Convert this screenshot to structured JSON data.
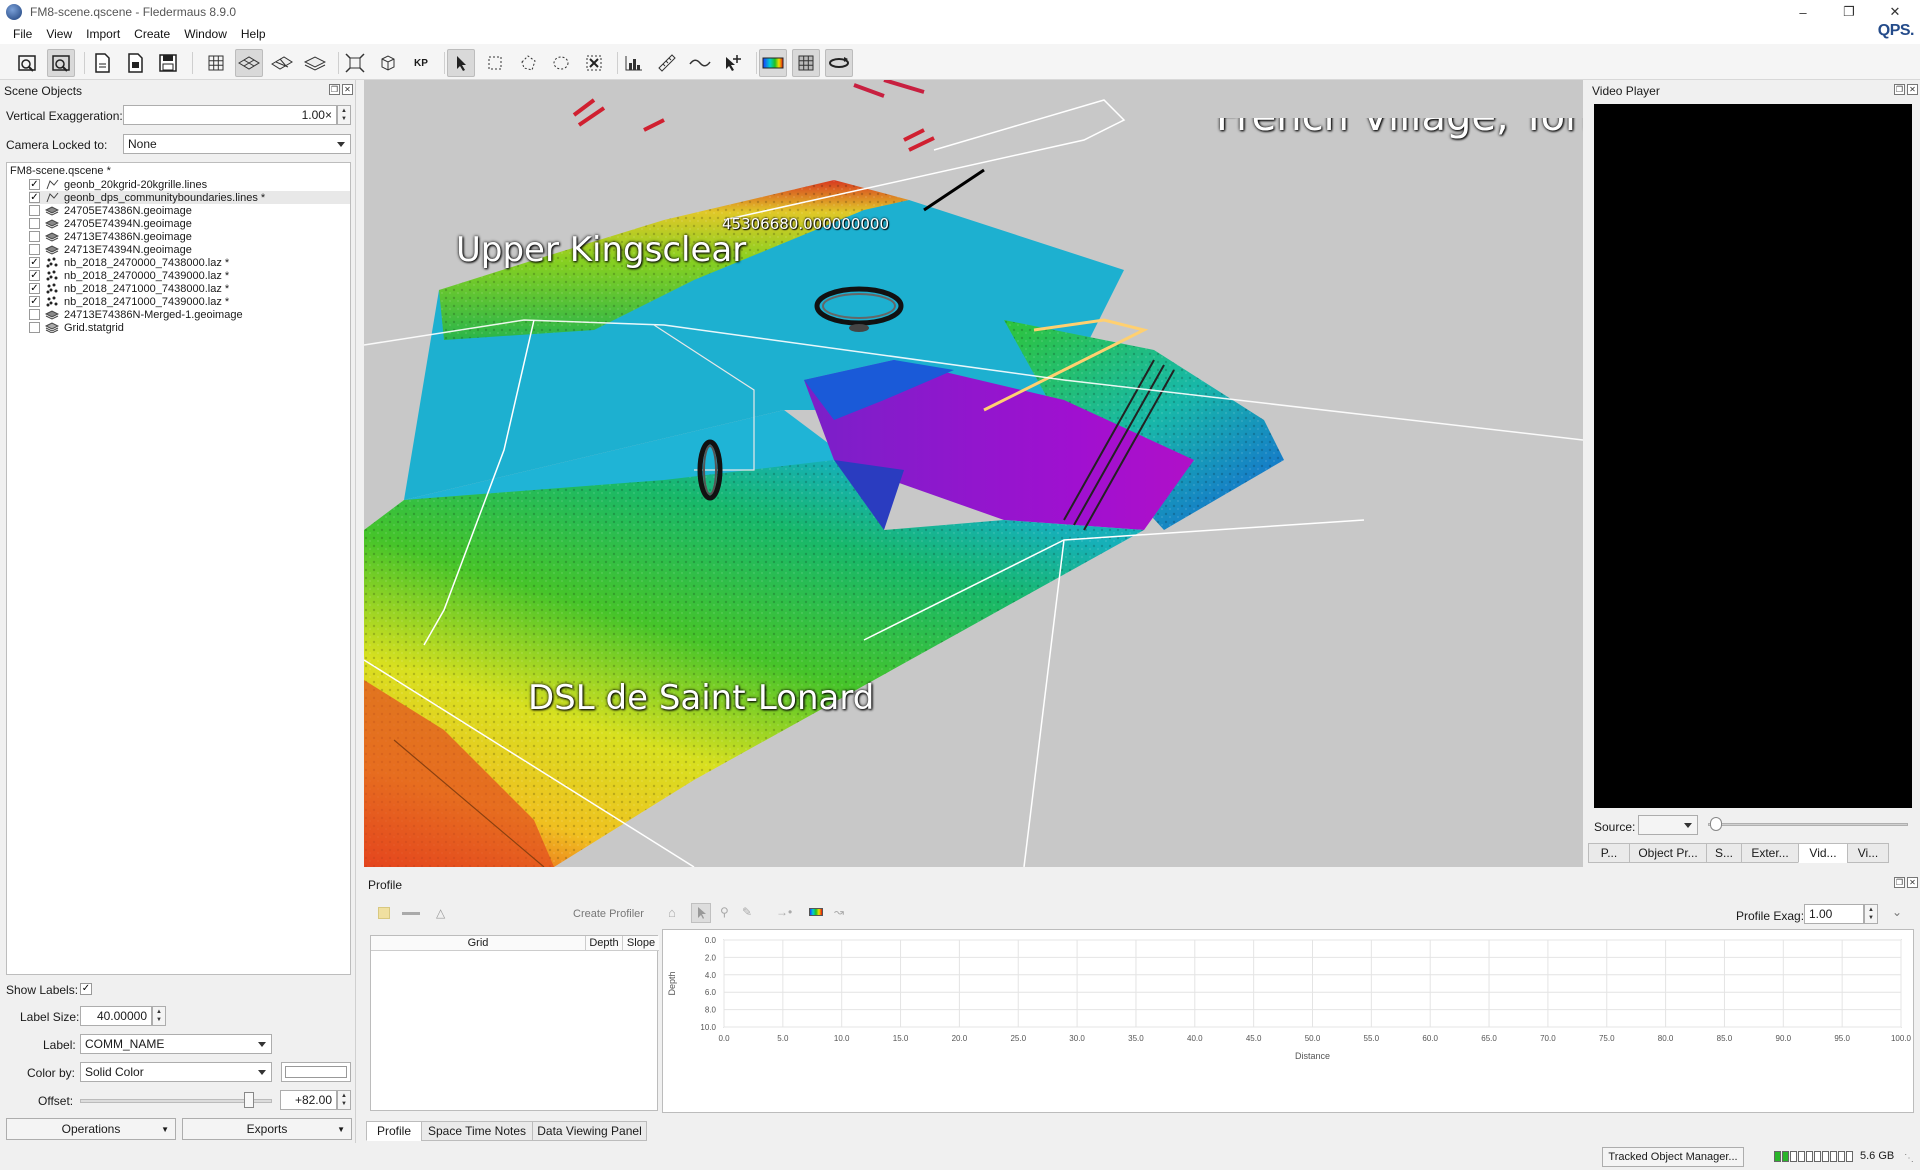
{
  "window": {
    "title": "FM8-scene.qscene - Fledermaus 8.9.0",
    "logo": "QPS."
  },
  "menu": [
    "File",
    "View",
    "Import",
    "Create",
    "Window",
    "Help"
  ],
  "toolbar": {
    "icons": [
      "open-scene-icon",
      "open-file-icon",
      "new-document-icon",
      "document-icon",
      "save-icon",
      "grid-icon",
      "layer-flat-icon",
      "layer-tilt-icon",
      "layer-stack-icon",
      "zoom-extents-icon",
      "cube-icon",
      "kp-icon",
      "pointer-icon",
      "rect-select-icon",
      "poly-select-icon",
      "lasso-select-icon",
      "clear-select-icon",
      "histogram-icon",
      "ruler-icon",
      "wave-icon",
      "add-point-icon",
      "colormap-icon",
      "sphere-grid-icon",
      "rotate-icon"
    ],
    "kp_label": "KP"
  },
  "scene_objects": {
    "header": "Scene Objects",
    "vertical_exaggeration_label": "Vertical Exaggeration:",
    "vertical_exaggeration_value": "1.00×",
    "camera_locked_label": "Camera Locked to:",
    "camera_locked_value": "None",
    "root": "FM8-scene.qscene *",
    "items": [
      {
        "label": "geonb_20kgrid-20kgrille.lines",
        "checked": true,
        "icon": "lines-icon"
      },
      {
        "label": "geonb_dps_communityboundaries.lines *",
        "checked": true,
        "icon": "lines-icon"
      },
      {
        "label": "24705E74386N.geoimage",
        "checked": false,
        "icon": "geoimage-icon"
      },
      {
        "label": "24705E74394N.geoimage",
        "checked": false,
        "icon": "geoimage-icon"
      },
      {
        "label": "24713E74386N.geoimage",
        "checked": false,
        "icon": "geoimage-icon"
      },
      {
        "label": "24713E74394N.geoimage",
        "checked": false,
        "icon": "geoimage-icon"
      },
      {
        "label": "nb_2018_2470000_7438000.laz *",
        "checked": true,
        "icon": "pointcloud-icon"
      },
      {
        "label": "nb_2018_2470000_7439000.laz *",
        "checked": true,
        "icon": "pointcloud-icon"
      },
      {
        "label": "nb_2018_2471000_7438000.laz *",
        "checked": true,
        "icon": "pointcloud-icon"
      },
      {
        "label": "nb_2018_2471000_7439000.laz *",
        "checked": true,
        "icon": "pointcloud-icon"
      },
      {
        "label": "24713E74386N-Merged-1.geoimage",
        "checked": false,
        "icon": "geoimage-icon"
      },
      {
        "label": "Grid.statgrid",
        "checked": false,
        "icon": "statgrid-icon"
      }
    ],
    "show_labels_label": "Show Labels:",
    "label_size_label": "Label Size:",
    "label_size_value": "40.00000",
    "label_label": "Label:",
    "label_value": "COMM_NAME",
    "color_by_label": "Color by:",
    "color_by_value": "Solid Color",
    "offset_label": "Offset:",
    "offset_value": "+82.00",
    "operations_button": "Operations",
    "exports_button": "Exports"
  },
  "viewport": {
    "labels": [
      "Upper Kingsclear",
      "DSL de Saint-Lonard"
    ],
    "coordinate_text": "45306680.000000000",
    "partial_label": "French Village, York C"
  },
  "video_player": {
    "header": "Video Player",
    "source_label": "Source:",
    "tabs": [
      "P...",
      "Object Pr...",
      "S...",
      "Exter...",
      "Vid...",
      "Vi..."
    ],
    "selected_tab": 4
  },
  "profile": {
    "header": "Profile",
    "create_profiler": "Create Profiler",
    "profile_exag_label": "Profile Exag:",
    "profile_exag_value": "1.00",
    "table_headers": [
      "Grid",
      "Depth",
      "Slope"
    ],
    "tabs": [
      "Profile",
      "Space Time Notes",
      "Data Viewing Panel"
    ],
    "selected_tab": 0
  },
  "chart_data": {
    "type": "line",
    "xlabel": "Distance",
    "ylabel": "Depth",
    "xlim": [
      0,
      100
    ],
    "ylim": [
      0,
      10
    ],
    "y_inverted": true,
    "x_ticks": [
      "0.0",
      "5.0",
      "10.0",
      "15.0",
      "20.0",
      "25.0",
      "30.0",
      "35.0",
      "40.0",
      "45.0",
      "50.0",
      "55.0",
      "60.0",
      "65.0",
      "70.0",
      "75.0",
      "80.0",
      "85.0",
      "90.0",
      "95.0",
      "100.0"
    ],
    "y_ticks": [
      "0.0",
      "2.0",
      "4.0",
      "6.0",
      "8.0",
      "10.0"
    ],
    "series": [],
    "grid": true
  },
  "status": {
    "tracked_object_button": "Tracked Object Manager...",
    "memory_text": "5.6 GB",
    "memory_fraction": 0.2
  }
}
